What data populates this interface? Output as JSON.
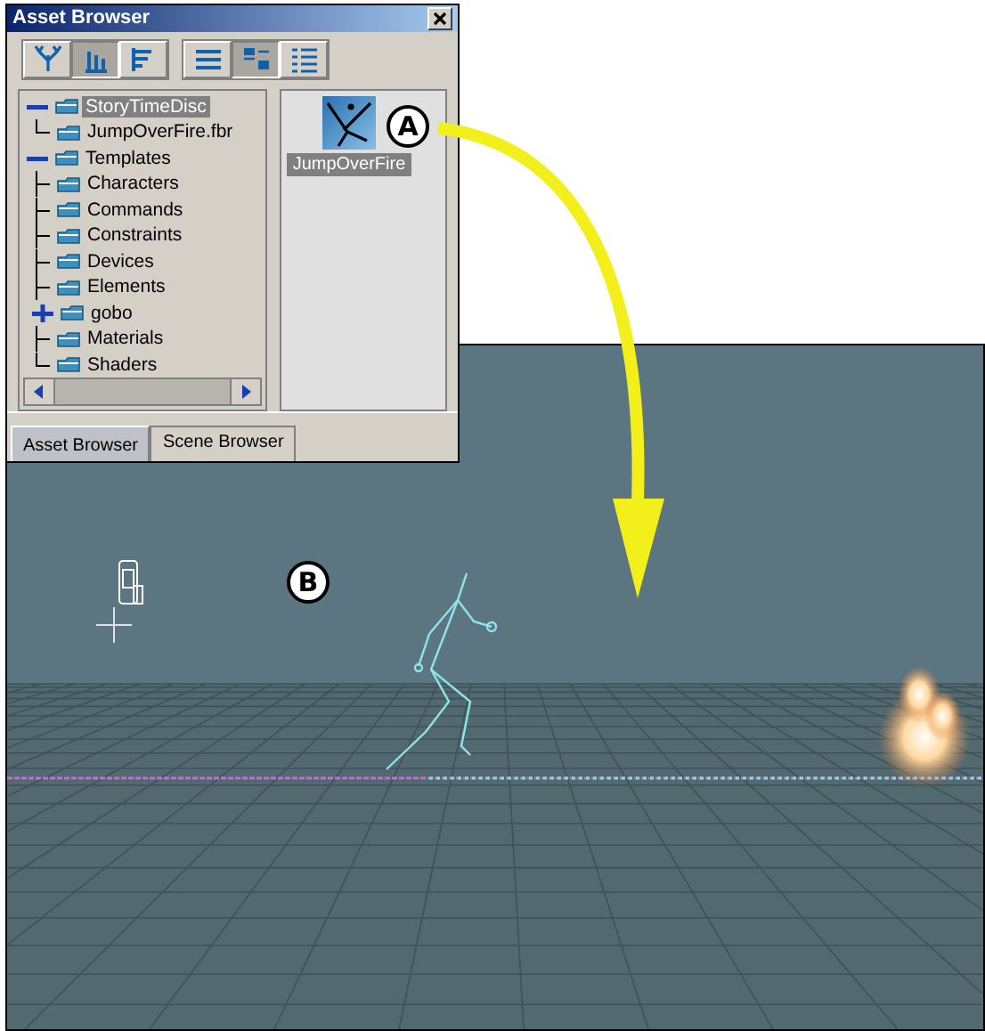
{
  "asset_browser": {
    "title": "Asset Browser",
    "toolbar": [
      {
        "kind": "tree",
        "selected": false
      },
      {
        "kind": "bars",
        "selected": true
      },
      {
        "kind": "hbars",
        "selected": false
      },
      {
        "kind": "list",
        "selected": false
      },
      {
        "kind": "thumbs",
        "selected": true
      },
      {
        "kind": "details",
        "selected": false
      }
    ],
    "tree": [
      {
        "label": "StoryTimeDisc",
        "expanded": true,
        "selected": true,
        "children": [
          {
            "label": "JumpOverFire.fbr",
            "selected": false
          }
        ]
      },
      {
        "label": "Templates",
        "expanded": true,
        "selected": false,
        "children": [
          {
            "label": "Characters",
            "selected": false
          },
          {
            "label": "Commands",
            "selected": false
          },
          {
            "label": "Constraints",
            "selected": false
          },
          {
            "label": "Devices",
            "selected": false
          },
          {
            "label": "Elements",
            "selected": false
          },
          {
            "label": "gobo",
            "expanded": false,
            "selected": false
          },
          {
            "label": "Materials",
            "selected": false
          },
          {
            "label": "Shaders",
            "selected": false
          }
        ]
      }
    ],
    "assets": [
      {
        "label": "JumpOverFire",
        "selected": true
      }
    ],
    "tabs": [
      {
        "label": "Asset Browser",
        "selected": true
      },
      {
        "label": "Scene Browser",
        "selected": false
      }
    ]
  },
  "callouts": [
    "A",
    "B"
  ]
}
